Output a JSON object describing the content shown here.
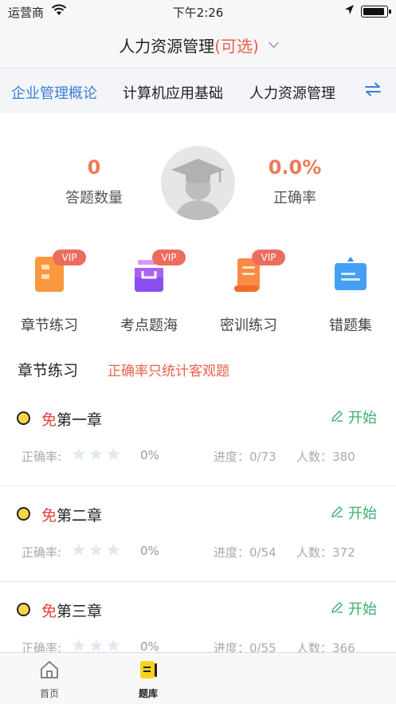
{
  "status_bar": {
    "carrier": "运营商",
    "time": "下午2:26"
  },
  "nav": {
    "title": "人力资源管理",
    "title_suffix": "(可选)"
  },
  "tabs": [
    {
      "label": "企业管理概论",
      "active": true
    },
    {
      "label": "计算机应用基础",
      "active": false
    },
    {
      "label": "人力资源管理",
      "active": false
    }
  ],
  "stats": {
    "answered": {
      "value": "0",
      "label": "答题数量"
    },
    "accuracy": {
      "value": "0.0%",
      "label": "正确率"
    }
  },
  "features": [
    {
      "label": "章节练习",
      "badge": "VIP",
      "icon": "chapter-book-icon",
      "color": "#f68a2e"
    },
    {
      "label": "考点题海",
      "badge": "VIP",
      "icon": "inbox-tray-icon",
      "color": "#8a4ef0"
    },
    {
      "label": "密训练习",
      "badge": "VIP",
      "icon": "scroll-icon",
      "color": "#f57a3a"
    },
    {
      "label": "错题集",
      "badge": "",
      "icon": "error-folder-icon",
      "color": "#2e8ef0"
    }
  ],
  "section": {
    "title": "章节练习",
    "note": "正确率只统计客观题"
  },
  "chapters": [
    {
      "free": "免",
      "name": "第一章",
      "accuracy_label": "正确率:",
      "stars": "★★★",
      "accuracy": "0%",
      "progress": "进度：0/73",
      "people": "人数：380",
      "start": "开始"
    },
    {
      "free": "免",
      "name": "第二章",
      "accuracy_label": "正确率:",
      "stars": "★★★",
      "accuracy": "0%",
      "progress": "进度：0/54",
      "people": "人数：372",
      "start": "开始"
    },
    {
      "free": "免",
      "name": "第三章",
      "accuracy_label": "正确率:",
      "stars": "★★★",
      "accuracy": "0%",
      "progress": "进度：0/55",
      "people": "人数：366",
      "start": "开始"
    }
  ],
  "tabbar": [
    {
      "label": "首页",
      "icon": "home-icon",
      "active": false
    },
    {
      "label": "题库",
      "icon": "question-bank-icon",
      "active": true
    }
  ]
}
